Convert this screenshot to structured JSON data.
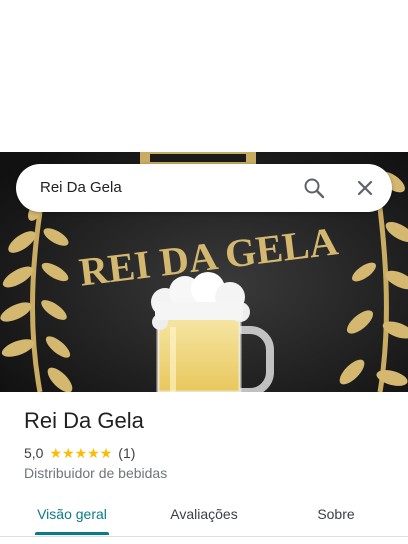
{
  "search": {
    "query": "Rei Da Gela"
  },
  "hero": {
    "sign_text": "REI DA GELA"
  },
  "place": {
    "name": "Rei Da Gela",
    "rating": "5,0",
    "stars": [
      "★",
      "★",
      "★",
      "★",
      "★"
    ],
    "review_count": "(1)",
    "category": "Distribuidor de bebidas"
  },
  "tabs": [
    {
      "label": "Visão geral",
      "active": true
    },
    {
      "label": "Avaliações",
      "active": false
    },
    {
      "label": "Sobre",
      "active": false
    }
  ],
  "colors": {
    "accent": "#0b7b8b",
    "star": "#fbbc04",
    "sign_gold": "#d4b870"
  }
}
